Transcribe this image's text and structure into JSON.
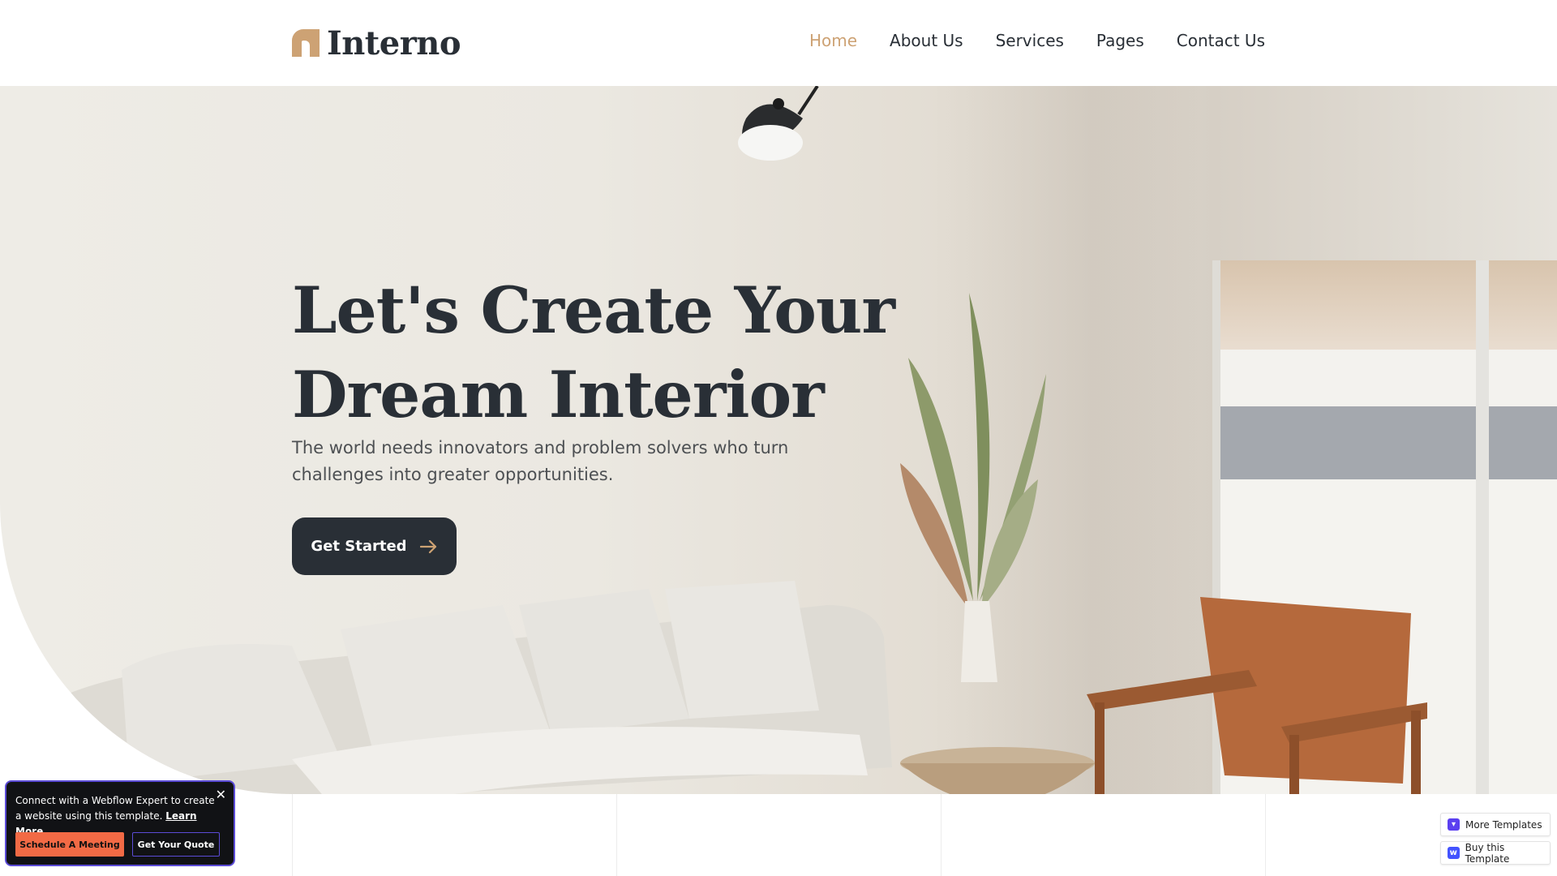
{
  "brand": {
    "name": "Interno",
    "accent": "#cda274",
    "dark": "#292f36"
  },
  "nav": {
    "items": [
      {
        "label": "Home",
        "active": true
      },
      {
        "label": "About Us",
        "active": false
      },
      {
        "label": "Services",
        "active": false
      },
      {
        "label": "Pages",
        "active": false
      },
      {
        "label": "Contact Us",
        "active": false
      }
    ]
  },
  "hero": {
    "title_line1": "Let's Create Your",
    "title_line2": "Dream Interior",
    "subtitle": "The world needs innovators and problem solvers who turn challenges into greater opportunities.",
    "cta_label": "Get Started",
    "cta_icon": "arrow-right-icon"
  },
  "promo": {
    "text": "Connect with a Webflow Expert to create a website using this template.",
    "link": "Learn More",
    "close_icon": "close-icon",
    "primary_button": "Schedule A Meeting",
    "secondary_button": "Get Your Quote",
    "primary_color": "#f26a45",
    "border_color": "#5b4bd6"
  },
  "template_badges": {
    "more_templates": "More Templates",
    "buy_template": "Buy this Template"
  }
}
